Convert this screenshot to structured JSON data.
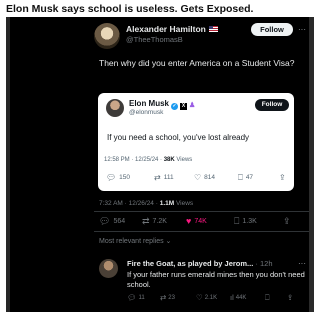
{
  "headline": "Elon Musk says school is useless. Gets Exposed.",
  "tweet": {
    "author_name": "Alexander Hamilton",
    "author_handle": "@TheeThomasB",
    "follow_label": "Follow",
    "more_glyph": "···",
    "text": "Then why did you enter America on a Student Visa?",
    "posted": "7:32 AM · 12/26/24 · ",
    "views_count": "1.1M",
    "views_label": " Views",
    "stats": {
      "replies": "564",
      "reposts": "7.2K",
      "likes": "74K",
      "bookmarks": "1.3K"
    }
  },
  "quoted": {
    "author_name": "Elon Musk",
    "author_handle": "@elonmusk",
    "follow_label": "Follow",
    "text": "If you need a school, you've lost already",
    "posted": "12:58 PM · 12/25/24 · ",
    "views_count": "38K",
    "views_label": " Views",
    "stats": {
      "replies": "150",
      "reposts": "111",
      "likes": "814",
      "bookmarks": "47"
    }
  },
  "relevant_replies_label": "Most relevant replies",
  "reply": {
    "author_name": "Fire the Goat, as played by Jerom...",
    "time": "· 12h",
    "more_glyph": "···",
    "text": "If your father runs emerald mines then you don't need school.",
    "stats": {
      "replies": "11",
      "reposts": "23",
      "likes": "2.1K",
      "views": "44K"
    }
  },
  "colors": {
    "background": "#000000",
    "text": "#e7e9ea",
    "muted": "#71767b",
    "like_active": "#f91880",
    "verified": "#1d9bf0"
  }
}
